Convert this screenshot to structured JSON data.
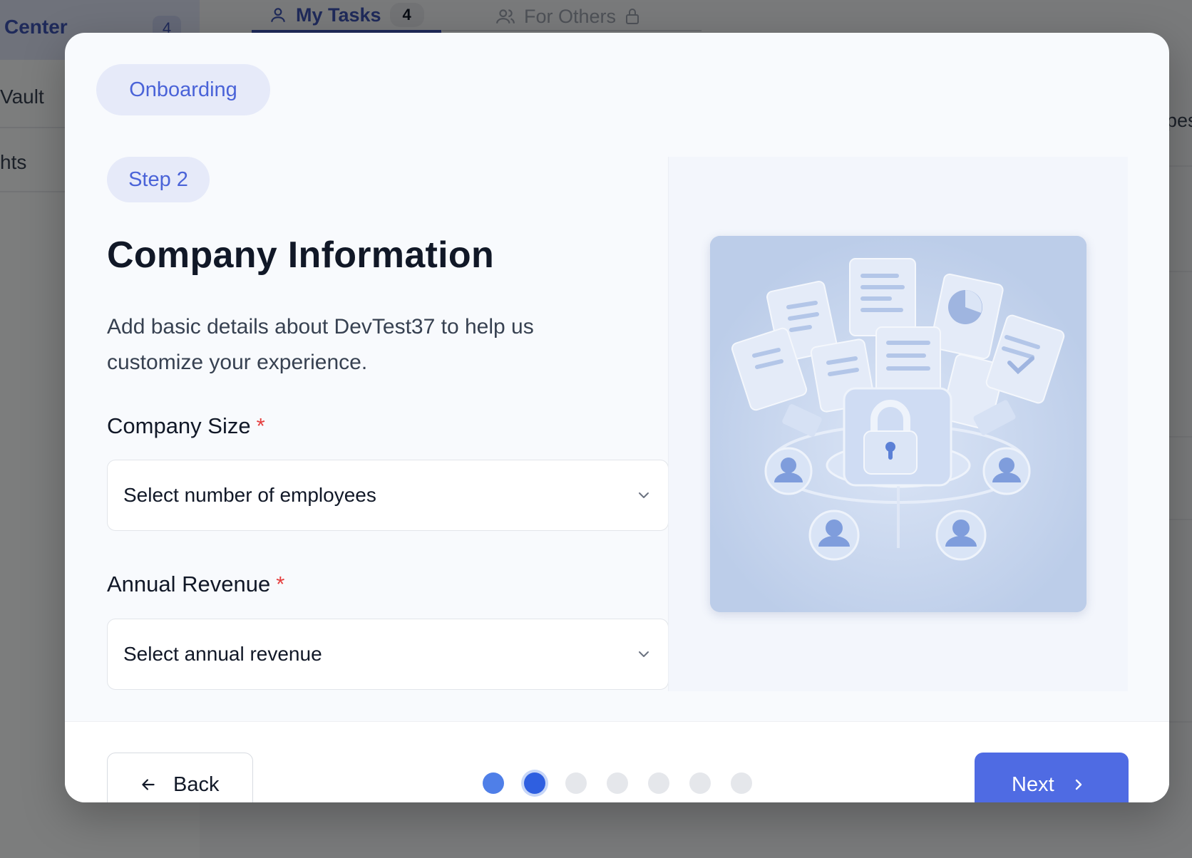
{
  "background": {
    "sidebar": {
      "active_label": "Center",
      "active_count": "4",
      "items": [
        "Vault",
        "hts"
      ]
    },
    "tabs": [
      {
        "label": "My Tasks",
        "count": "4"
      },
      {
        "label": "For Others"
      }
    ],
    "right_partial_text": "pes"
  },
  "modal": {
    "badge": "Onboarding",
    "step": "Step 2",
    "title": "Company Information",
    "description": "Add basic details about DevTest37 to help us customize your experience.",
    "fields": {
      "company_size": {
        "label": "Company Size",
        "required_mark": "*",
        "placeholder": "Select number of employees"
      },
      "annual_revenue": {
        "label": "Annual Revenue",
        "required_mark": "*",
        "placeholder": "Select annual revenue"
      }
    },
    "footer": {
      "back_label": "Back",
      "next_label": "Next",
      "progress": {
        "total_steps": 7,
        "current_step": 2
      }
    }
  },
  "icons": {
    "tab_mytasks": "user-icon",
    "tab_others": "users-icon",
    "tab_lock": "lock-icon",
    "select_chevron": "chevron-down-icon",
    "back": "arrow-left-icon",
    "next": "chevron-right-icon"
  },
  "colors": {
    "accent": "#4f6be3",
    "pill_bg": "#e6eaf9",
    "pill_text": "#4a63d8",
    "required": "#e53e3e",
    "dot_active": "#2f5fe0"
  }
}
